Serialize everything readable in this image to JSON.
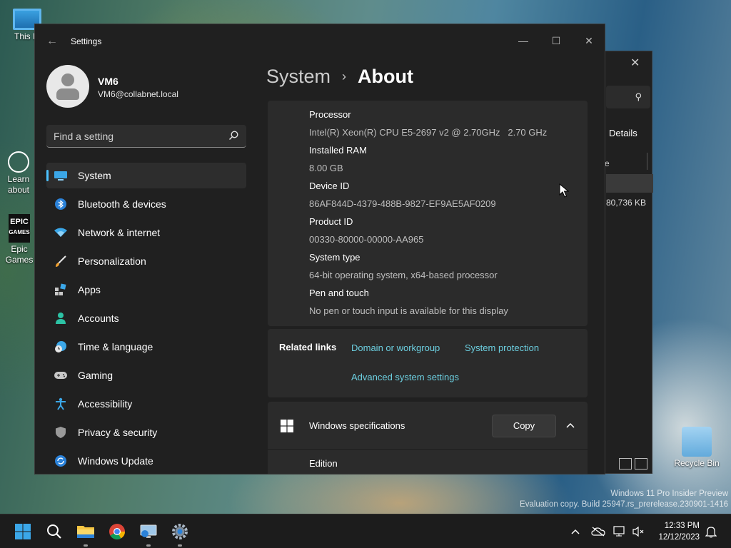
{
  "desktop": {
    "icons": [
      {
        "label": "This PC"
      },
      {
        "label": "Learn about this picture"
      },
      {
        "label": "Epic Games Launcher"
      },
      {
        "label": "Recycle Bin"
      }
    ],
    "watermark_line1": "Windows 11 Pro Insider Preview",
    "watermark_line2": "Evaluation copy. Build 25947.rs_prerelease.230901-1416"
  },
  "background_window": {
    "details_label": "Details",
    "column_fragment": "e",
    "size_value": "80,736 KB"
  },
  "window": {
    "title": "Settings",
    "minimize_glyph": "—",
    "maximize_glyph": "☐",
    "close_glyph": "✕"
  },
  "user": {
    "name": "VM6",
    "email": "VM6@collabnet.local"
  },
  "search": {
    "placeholder": "Find a setting"
  },
  "nav": {
    "items": [
      {
        "label": "System",
        "icon": "system-icon",
        "active": true
      },
      {
        "label": "Bluetooth & devices",
        "icon": "bluetooth-icon"
      },
      {
        "label": "Network & internet",
        "icon": "network-icon"
      },
      {
        "label": "Personalization",
        "icon": "brush-icon"
      },
      {
        "label": "Apps",
        "icon": "apps-icon"
      },
      {
        "label": "Accounts",
        "icon": "person-icon"
      },
      {
        "label": "Time & language",
        "icon": "clock-globe-icon"
      },
      {
        "label": "Gaming",
        "icon": "gamepad-icon"
      },
      {
        "label": "Accessibility",
        "icon": "accessibility-icon"
      },
      {
        "label": "Privacy & security",
        "icon": "shield-icon"
      },
      {
        "label": "Windows Update",
        "icon": "update-icon"
      }
    ]
  },
  "breadcrumb": {
    "parent": "System",
    "separator": "›",
    "current": "About"
  },
  "device_specs": [
    {
      "label": "Processor",
      "value": "Intel(R) Xeon(R) CPU E5-2697 v2 @ 2.70GHz   2.70 GHz"
    },
    {
      "label": "Installed RAM",
      "value": "8.00 GB"
    },
    {
      "label": "Device ID",
      "value": "86AF844D-4379-488B-9827-EF9AE5AF0209"
    },
    {
      "label": "Product ID",
      "value": "00330-80000-00000-AA965"
    },
    {
      "label": "System type",
      "value": "64-bit operating system, x64-based processor"
    },
    {
      "label": "Pen and touch",
      "value": "No pen or touch input is available for this display"
    }
  ],
  "related_links": {
    "title": "Related links",
    "links": [
      "Domain or workgroup",
      "System protection",
      "Advanced system settings"
    ]
  },
  "windows_specs": {
    "title": "Windows specifications",
    "copy_label": "Copy",
    "first_field": "Edition"
  },
  "taskbar": {
    "apps": [
      "start-button",
      "search-button",
      "file-explorer",
      "chrome",
      "remote-desktop",
      "settings"
    ]
  },
  "clock": {
    "time": "12:33 PM",
    "date": "12/12/2023"
  },
  "colors": {
    "accent": "#4cc2ff",
    "link": "#6ccfe0",
    "window_bg": "#202020",
    "card_bg": "#2b2b2b"
  }
}
